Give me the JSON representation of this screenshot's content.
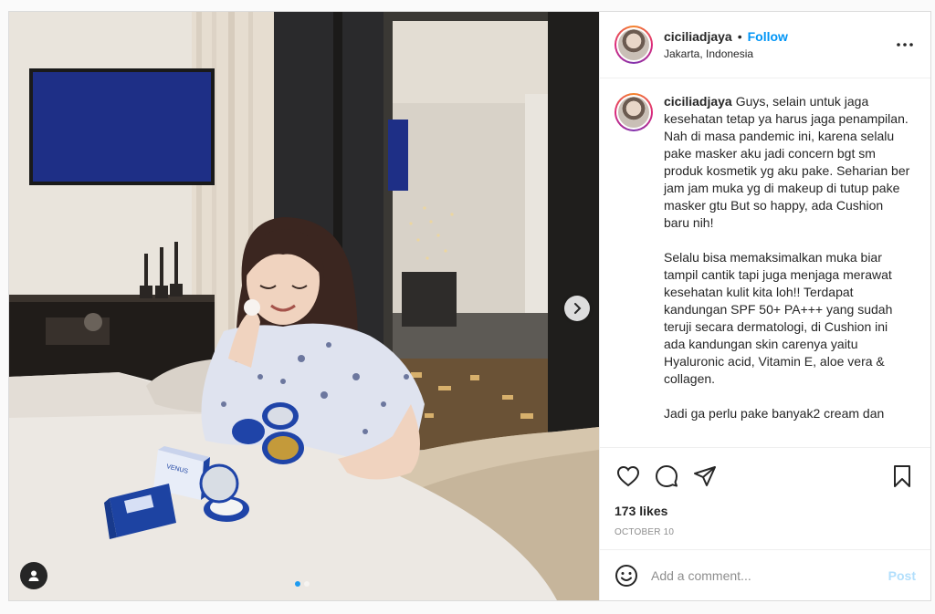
{
  "post": {
    "username": "ciciliadjaya",
    "follow_label": "Follow",
    "bullet": "•",
    "location": "Jakarta, Indonesia",
    "caption": "Guys, selain untuk jaga kesehatan tetap ya harus jaga penampilan. Nah di masa pandemic ini, karena selalu pake masker aku jadi concern bgt sm produk kosmetik yg aku pake. Seharian ber jam jam muka yg di makeup di tutup pake masker gtu But so happy, ada Cushion baru nih!\n\nSelalu bisa memaksimalkan muka biar tampil cantik tapi juga menjaga merawat kesehatan kulit kita loh!! Terdapat kandungan SPF 50+ PA+++ yang sudah teruji secara dermatologi, di Cushion ini ada kandungan skin carenya yaitu Hyaluronic acid, Vitamin E, aloe vera & collagen.\n\nJadi ga perlu pake banyak2 cream dan",
    "likes": "173 likes",
    "date": "OCTOBER 10",
    "comment_placeholder": "Add a comment...",
    "post_label": "Post",
    "carousel": {
      "total": 2,
      "active": 1
    },
    "product_label": "VENUS"
  },
  "colors": {
    "accent": "#0095f6",
    "post_disabled": "#b2dffc",
    "text": "#262626",
    "muted": "#8e8e8e",
    "carousel_active_dot": "#1e9bf0"
  }
}
